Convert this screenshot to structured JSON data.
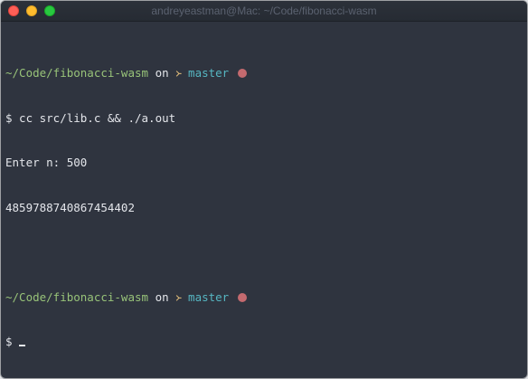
{
  "window": {
    "title": "andreyeastman@Mac: ~/Code/fibonacci-wasm"
  },
  "terminal": {
    "prompt1": {
      "path": "~/Code/fibonacci-wasm",
      "on": "on",
      "branch_icon": "᚛",
      "branch": "master"
    },
    "command_line": "$ cc src/lib.c && ./a.out",
    "output": [
      "Enter n: 500",
      "4859788740867454402"
    ],
    "prompt2": {
      "path": "~/Code/fibonacci-wasm",
      "on": "on",
      "branch_icon": "᚛",
      "branch": "master"
    },
    "current_input": "$ "
  }
}
